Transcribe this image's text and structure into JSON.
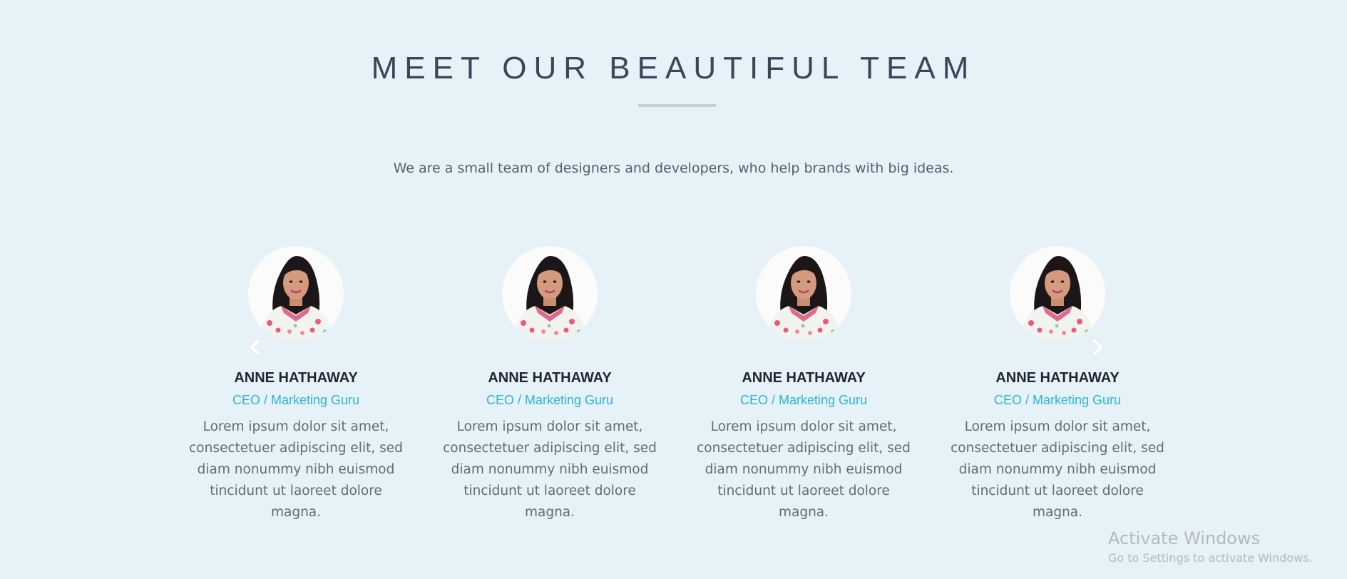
{
  "section": {
    "title": "MEET OUR BEAUTIFUL TEAM",
    "subtitle": "We are a small team of designers and developers, who help brands with big ideas."
  },
  "carousel": {
    "prev_icon": "chevron-left-icon",
    "next_icon": "chevron-right-icon"
  },
  "members": [
    {
      "name": "ANNE HATHAWAY",
      "role": "CEO / Marketing Guru",
      "bio": "Lorem ipsum dolor sit amet, consectetuer adipiscing elit, sed diam nonummy nibh euismod tincidunt ut laoreet dolore magna."
    },
    {
      "name": "ANNE HATHAWAY",
      "role": "CEO / Marketing Guru",
      "bio": "Lorem ipsum dolor sit amet, consectetuer adipiscing elit, sed diam nonummy nibh euismod tincidunt ut laoreet dolore magna."
    },
    {
      "name": "ANNE HATHAWAY",
      "role": "CEO / Marketing Guru",
      "bio": "Lorem ipsum dolor sit amet, consectetuer adipiscing elit, sed diam nonummy nibh euismod tincidunt ut laoreet dolore magna."
    },
    {
      "name": "ANNE HATHAWAY",
      "role": "CEO / Marketing Guru",
      "bio": "Lorem ipsum dolor sit amet, consectetuer adipiscing elit, sed diam nonummy nibh euismod tincidunt ut laoreet dolore magna."
    }
  ],
  "watermark": {
    "title": "Activate Windows",
    "subtitle": "Go to Settings to activate Windows."
  },
  "colors": {
    "background": "#e6f1f8",
    "title": "#3b4759",
    "role_accent": "#2bb6d8",
    "divider": "#c7d0d7"
  }
}
